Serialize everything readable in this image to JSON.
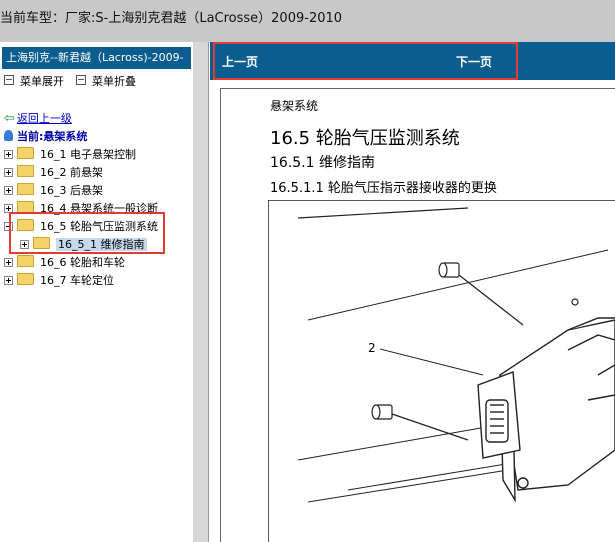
{
  "window": {
    "title": "当前车型：厂家:S-上海别克君越（LaCrosse）2009-2010"
  },
  "left_pane": {
    "header": "上海别克--新君越（Lacross)-2009-",
    "expand_all": "菜单展开",
    "collapse_all": "菜单折叠",
    "back_link": "返回上一级",
    "current_label": "当前:悬架系统",
    "tree": [
      {
        "label": "16_1 电子悬架控制",
        "expanded": false
      },
      {
        "label": "16_2 前悬架",
        "expanded": false
      },
      {
        "label": "16_3 后悬架",
        "expanded": false
      },
      {
        "label": "16_4 悬架系统一般诊断",
        "expanded": false
      },
      {
        "label": "16_5 轮胎气压监测系统",
        "expanded": true
      },
      {
        "label": "16_5_1 维修指南",
        "expanded": false,
        "selected": true
      },
      {
        "label": "16_6 轮胎和车轮",
        "expanded": false
      },
      {
        "label": "16_7 车轮定位",
        "expanded": false
      }
    ]
  },
  "content": {
    "prev_label": "上一页",
    "next_label": "下一页",
    "section": "悬架系统",
    "heading1": "16.5 轮胎气压监测系统",
    "heading2": "16.5.1 维修指南",
    "heading3": "16.5.1.1 轮胎气压指示器接收器的更换",
    "figure_callout": "2"
  },
  "colors": {
    "titlebar_bg": "#c8c8c8",
    "nav_blue": "#0a5d8e",
    "highlight_red": "#e53935",
    "selection_bg": "#c6d8ee",
    "link_blue": "#0000cc"
  },
  "icons": [
    "expand-icon",
    "collapse-icon",
    "back-arrow-icon",
    "pin-icon",
    "folder-icon",
    "tree-expander-icon"
  ]
}
